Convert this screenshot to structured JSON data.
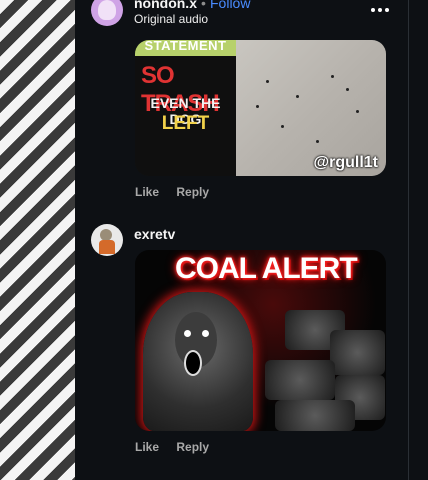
{
  "header": {
    "username": "nondon.x",
    "separator": "•",
    "follow_label": "Follow",
    "subtitle": "Original audio"
  },
  "comments": [
    {
      "media": {
        "banner_text": "STATEMENT",
        "headline_red": "SO TRASH",
        "line_white": "EVEN THE DOG",
        "line_yellow": "LEFT",
        "watermark": "@rgull1t"
      },
      "actions": {
        "like": "Like",
        "reply": "Reply"
      }
    },
    {
      "username": "exretv",
      "media": {
        "title": "COAL ALERT"
      },
      "actions": {
        "like": "Like",
        "reply": "Reply"
      }
    }
  ],
  "colors": {
    "panel_bg": "#0d1014",
    "follow_blue": "#4a8cff",
    "action_grey": "#a9a9a9",
    "alert_red": "#ff2a2a"
  },
  "icons": [
    "more-options-icon"
  ]
}
